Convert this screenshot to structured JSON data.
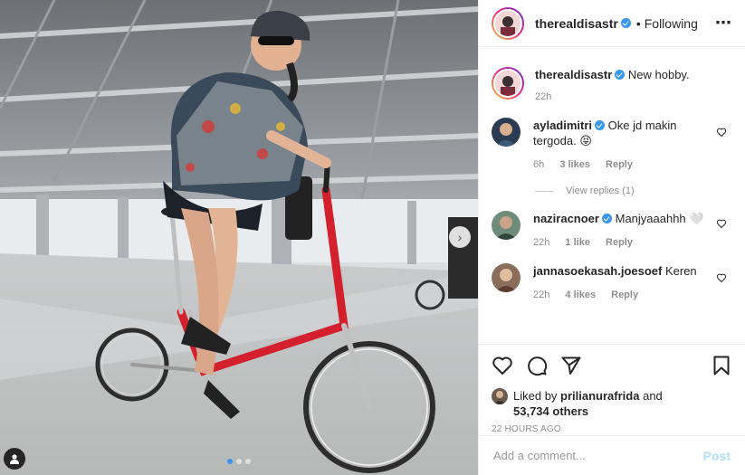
{
  "post": {
    "image_alt": "Woman in a helmet and sunglasses riding a red folding bicycle in a parking structure",
    "carousel_index": 1,
    "carousel_total": 3
  },
  "header": {
    "username": "therealdisastr",
    "separator": "•",
    "follow_status": "Following",
    "more_icon": "more-options-icon"
  },
  "caption": {
    "username": "therealdisastr",
    "text": "New hobby.",
    "time": "22h"
  },
  "comments": [
    {
      "username": "ayladimitri",
      "verified": true,
      "text": "Oke jd makin tergoda. 😝",
      "time": "6h",
      "likes": "3 likes",
      "reply": "Reply",
      "view_replies": "View replies (1)"
    },
    {
      "username": "naziracnoer",
      "verified": true,
      "text": "Manjyaaahhh 🤍",
      "time": "22h",
      "likes": "1 like",
      "reply": "Reply"
    },
    {
      "username": "jannasoekasah.joesoef",
      "verified": false,
      "text": "Keren",
      "time": "22h",
      "likes": "4 likes",
      "reply": "Reply"
    }
  ],
  "actions": {
    "like_icon": "heart-icon",
    "comment_icon": "comment-icon",
    "share_icon": "share-icon",
    "save_icon": "bookmark-icon"
  },
  "likes": {
    "prefix": "Liked by",
    "first_user": "prilianurafrida",
    "and": "and",
    "others": "53,734 others"
  },
  "timestamp": "22 HOURS AGO",
  "add_comment": {
    "placeholder": "Add a comment...",
    "post_label": "Post"
  },
  "colors": {
    "accent": "#3897f0",
    "post_button": "#b2dffc",
    "text": "#262626",
    "muted": "#8e8e8e"
  }
}
